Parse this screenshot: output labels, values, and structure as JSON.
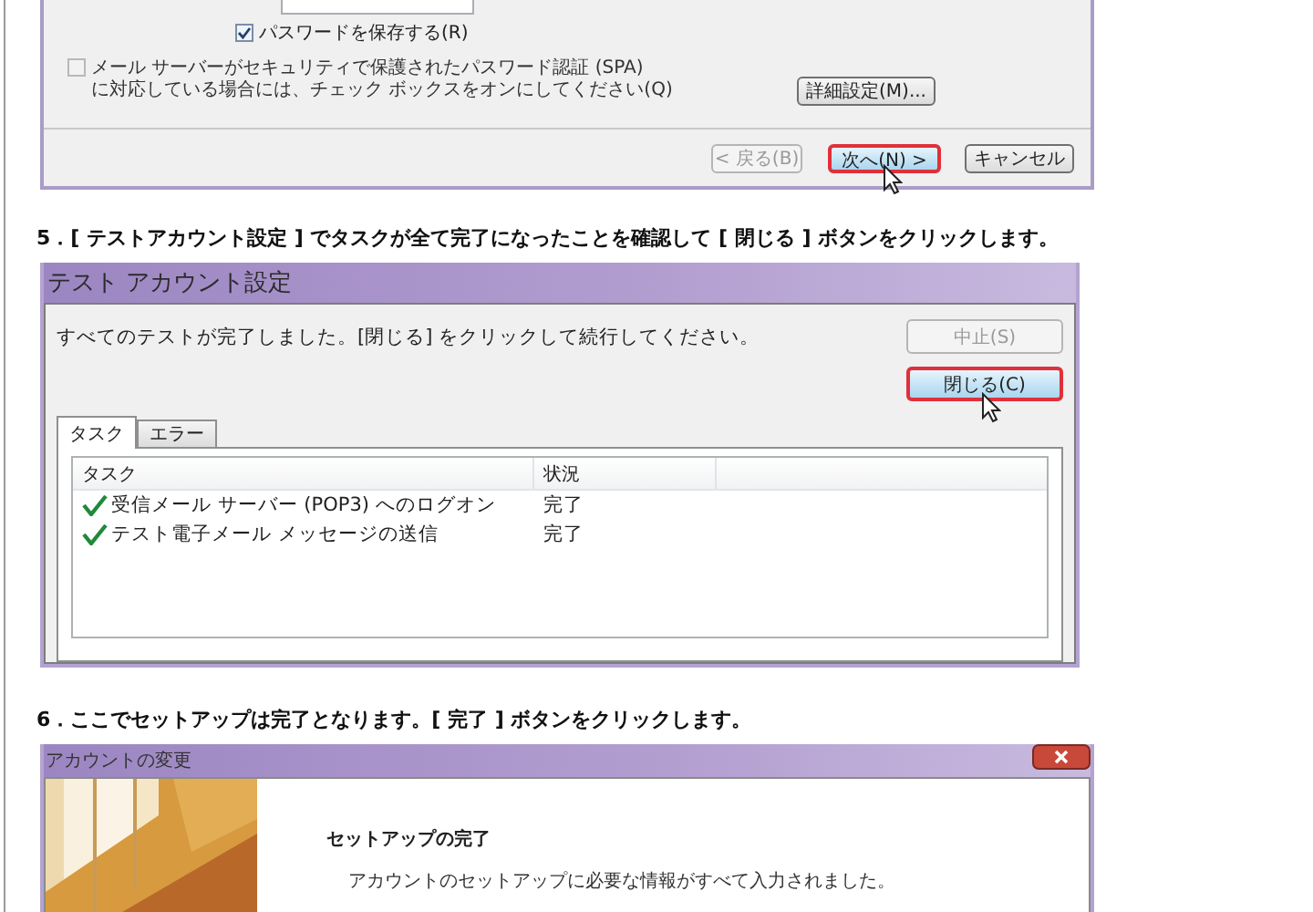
{
  "account_dialog": {
    "save_password": {
      "label": "パスワードを保存する(R)",
      "checked": true
    },
    "spa": {
      "label": "メール サーバーがセキュリティで保護されたパスワード認証 (SPA)\nに対応している場合には、チェック ボックスをオンにしてください(Q)",
      "checked": false
    },
    "advanced_button": "詳細設定(M)...",
    "buttons": [
      {
        "label": "< 戻る(B)",
        "disabled": true,
        "highlighted": false,
        "cursor": false
      },
      {
        "label": "次へ(N) >",
        "disabled": false,
        "highlighted": true,
        "cursor": true
      },
      {
        "label": "キャンセル",
        "disabled": false,
        "highlighted": false,
        "cursor": false
      }
    ]
  },
  "step_5": "5．[ テストアカウント設定 ] でタスクが全て完了になったことを確認して [ 閉じる ] ボタンをクリックします。",
  "test_dialog": {
    "title": "テスト アカウント設定",
    "message": "すべてのテストが完了しました。[閉じる] をクリックして続行してください。",
    "buttons": [
      {
        "label": "中止(S)",
        "disabled": true,
        "highlighted": false,
        "cursor": false
      },
      {
        "label": "閉じる(C)",
        "disabled": false,
        "highlighted": true,
        "cursor": true
      }
    ],
    "tabs": [
      {
        "label": "タスク",
        "selected": true
      },
      {
        "label": "エラー",
        "selected": false
      }
    ],
    "columns": [
      "タスク",
      "状況"
    ],
    "rows": [
      {
        "task": "受信メール サーバー (POP3) へのログオン",
        "status": "完了",
        "done": true
      },
      {
        "task": "テスト電子メール メッセージの送信",
        "status": "完了",
        "done": true
      }
    ]
  },
  "step_6": "6．ここでセットアップは完了となります。[ 完了 ] ボタンをクリックします。",
  "change_dialog": {
    "title": "アカウントの変更",
    "heading": "セットアップの完了",
    "lines": [
      "アカウントのセットアップに必要な情報がすべて入力されました。"
    ]
  }
}
